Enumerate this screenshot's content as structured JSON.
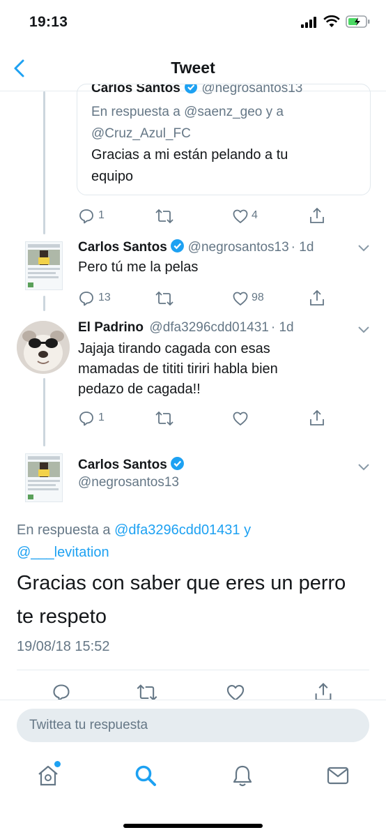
{
  "status_bar": {
    "time": "19:13"
  },
  "nav": {
    "title": "Tweet"
  },
  "quoted_tweet": {
    "name_partial": "Carlos Santos",
    "handle_partial": "@negrosantos13",
    "reply_prefix": "En respuesta a",
    "reply_user1": "@saenz_geo",
    "reply_and": "y a",
    "reply_user2": "@Cruz_Azul_FC",
    "text_line1": "Gracias a mi están pelando a tu",
    "text_line2": "equipo",
    "replies": "1",
    "likes": "4"
  },
  "tweet1": {
    "name": "Carlos Santos",
    "handle": "@negrosantos13",
    "time": "· 1d",
    "text": "Pero tú me la pelas",
    "replies": "13",
    "likes": "98"
  },
  "tweet2": {
    "name": "El Padrino",
    "handle": "@dfa3296cdd01431",
    "time": "· 1d",
    "text_line1": "Jajaja tirando cagada con esas",
    "text_line2": "mamadas de tititi tiriri habla bien",
    "text_line3": "pedazo de cagada!!",
    "replies": "1"
  },
  "main_tweet": {
    "name": "Carlos Santos",
    "handle": "@negrosantos13",
    "reply_prefix": "En respuesta a",
    "reply_user1": "@dfa3296cdd01431",
    "reply_and": "y",
    "reply_user2": "@___levitation",
    "text_line1": "Gracias con saber que eres un perro",
    "text_line2": "te respeto",
    "timestamp": "19/08/18 15:52"
  },
  "reply_bar": {
    "placeholder": "Twittea tu respuesta"
  },
  "tab_bar": {
    "items": [
      "home",
      "search",
      "notifications",
      "messages"
    ]
  },
  "colors": {
    "accent": "#1da1f2",
    "verified": "#1da1f2",
    "muted": "#657786",
    "border": "#e6ecf0"
  }
}
